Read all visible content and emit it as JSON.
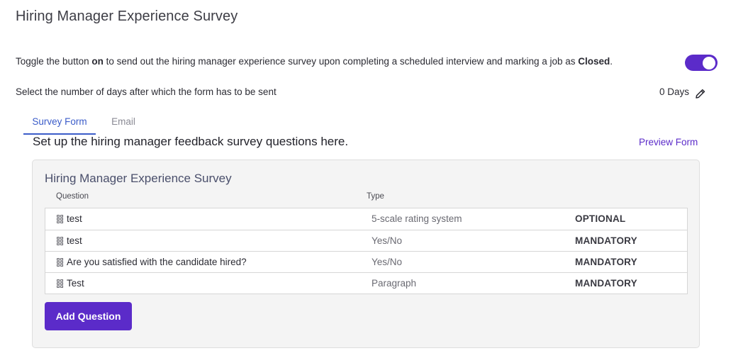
{
  "page": {
    "title": "Hiring Manager Experience Survey"
  },
  "toggle_setting": {
    "text_before": "Toggle the button ",
    "text_on": "on",
    "text_middle": " to send out the hiring manager experience survey upon completing a scheduled interview and marking a job as ",
    "text_closed": "Closed",
    "text_after": ".",
    "enabled": true,
    "color": "#5b2bc9"
  },
  "days_setting": {
    "label": "Select the number of days after which the form has to be sent",
    "value": "0 Days",
    "icon": "pencil-icon"
  },
  "tabs": [
    {
      "label": "Survey Form",
      "active": true
    },
    {
      "label": "Email",
      "active": false
    }
  ],
  "survey": {
    "subtitle": "Set up the hiring manager feedback survey questions here.",
    "preview_link": "Preview Form",
    "card_title": "Hiring Manager Experience Survey",
    "columns": {
      "question": "Question",
      "type": "Type"
    },
    "rows": [
      {
        "question": "test",
        "type": "5-scale rating system",
        "requirement": "OPTIONAL"
      },
      {
        "question": "test",
        "type": "Yes/No",
        "requirement": "MANDATORY"
      },
      {
        "question": "Are you satisfied with the candidate hired?",
        "type": "Yes/No",
        "requirement": "MANDATORY"
      },
      {
        "question": "Test",
        "type": "Paragraph",
        "requirement": "MANDATORY"
      }
    ],
    "add_button": "Add Question"
  },
  "colors": {
    "accent": "#5b2bc9",
    "tab_active": "#3b5cc9"
  }
}
